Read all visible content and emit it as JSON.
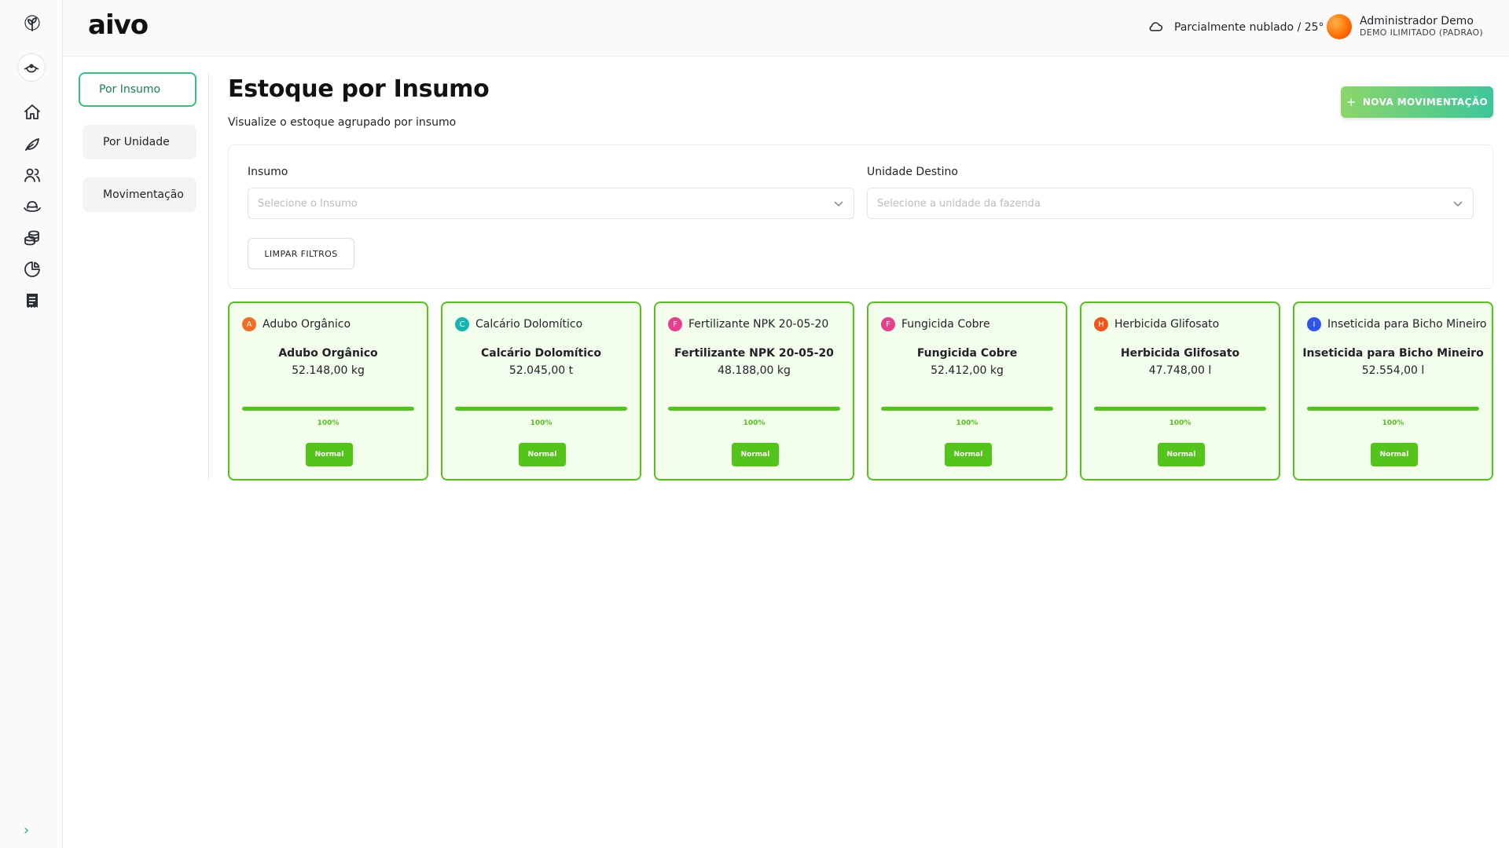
{
  "app": {
    "brand": "aivo"
  },
  "rail": {
    "icons": [
      "plant-logo-icon",
      "farm-logo-icon",
      "home-icon",
      "leaf-icon",
      "users-icon",
      "cowboy-hat-icon",
      "coins-icon",
      "pie-chart-icon",
      "receipt-icon"
    ],
    "expand": "›"
  },
  "header": {
    "weather": "Parcialmente nublado / 25°",
    "user_name": "Administrador Demo",
    "user_plan": "DEMO ILIMITADO (PADRAO)"
  },
  "subnav": {
    "items": [
      {
        "label": "Por Insumo",
        "active": true
      },
      {
        "label": "Por Unidade",
        "active": false
      },
      {
        "label": "Movimentação",
        "active": false
      }
    ]
  },
  "page": {
    "title": "Estoque por Insumo",
    "subtitle": "Visualize o estoque agrupado por insumo",
    "new_button": "NOVA MOVIMENTAÇÃO",
    "new_button_icon": "+"
  },
  "filters": {
    "insumo_label": "Insumo",
    "insumo_placeholder": "Selecione o Insumo",
    "unidade_label": "Unidade Destino",
    "unidade_placeholder": "Selecione a unidade da fazenda",
    "clear_button": "LIMPAR FILTROS"
  },
  "colors": {
    "accent": "#52c41a",
    "brand_green": "#35c17b"
  },
  "cards": [
    {
      "letter": "A",
      "letter_color": "#f26d21",
      "name": "Adubo Orgânico",
      "title": "Adubo Orgânico",
      "quantity": "52.148,00 kg",
      "percent_label": "100%",
      "percent": 100,
      "status": "Normal"
    },
    {
      "letter": "C",
      "letter_color": "#13b5b1",
      "name": "Calcário Dolomítico",
      "title": "Calcário Dolomítico",
      "quantity": "52.045,00 t",
      "percent_label": "100%",
      "percent": 100,
      "status": "Normal"
    },
    {
      "letter": "F",
      "letter_color": "#e83e8c",
      "name": "Fertilizante NPK 20-05-20",
      "title": "Fertilizante NPK 20-05-20",
      "quantity": "48.188,00 kg",
      "percent_label": "100%",
      "percent": 100,
      "status": "Normal"
    },
    {
      "letter": "F",
      "letter_color": "#e83e8c",
      "name": "Fungicida Cobre",
      "title": "Fungicida Cobre",
      "quantity": "52.412,00 kg",
      "percent_label": "100%",
      "percent": 100,
      "status": "Normal"
    },
    {
      "letter": "H",
      "letter_color": "#f2541b",
      "name": "Herbicida Glifosato",
      "title": "Herbicida Glifosato",
      "quantity": "47.748,00 l",
      "percent_label": "100%",
      "percent": 100,
      "status": "Normal"
    },
    {
      "letter": "I",
      "letter_color": "#2f54eb",
      "name": "Inseticida para Bicho Mineiro",
      "title": "Inseticida para Bicho Mineiro",
      "quantity": "52.554,00 l",
      "percent_label": "100%",
      "percent": 100,
      "status": "Normal"
    }
  ]
}
